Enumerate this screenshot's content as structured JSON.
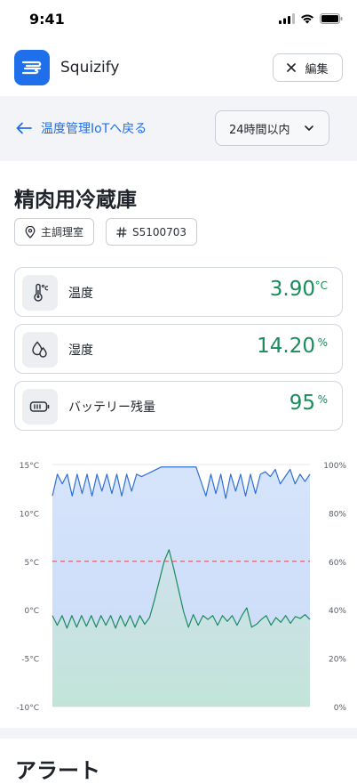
{
  "status": {
    "time": "9:41"
  },
  "app": {
    "name": "Squizify",
    "edit_label": "編集"
  },
  "nav": {
    "back_label": "温度管理IoTへ戻る",
    "range_label": "24時間以内"
  },
  "device": {
    "name": "精肉用冷蔵庫",
    "location": "主調理室",
    "serial": "S5100703"
  },
  "metrics": [
    {
      "icon": "thermometer-icon",
      "label": "温度",
      "value": "3.90",
      "unit": "°C"
    },
    {
      "icon": "humidity-icon",
      "label": "湿度",
      "value": "14.20",
      "unit": "%"
    },
    {
      "icon": "battery-icon",
      "label": "バッテリー残量",
      "value": "95",
      "unit": "%"
    }
  ],
  "colors": {
    "accent": "#1f6feb",
    "value_green": "#1a8c5c",
    "threshold_red": "#e0454f"
  },
  "chart_data": {
    "type": "area",
    "left_axis": {
      "label": "",
      "unit": "°C",
      "ticks": [
        "15°C",
        "10°C",
        "5°C",
        "0°C",
        "-5°C",
        "-10°C"
      ],
      "range": [
        -10,
        15
      ]
    },
    "right_axis": {
      "label": "",
      "unit": "%",
      "ticks": [
        "100%",
        "80%",
        "60%",
        "40%",
        "20%",
        "0%"
      ],
      "range": [
        0,
        100
      ]
    },
    "threshold": 5,
    "series": [
      {
        "axis": "right",
        "color": "#2f6fd6",
        "values": [
          87,
          96,
          92,
          96,
          87,
          96,
          88,
          96,
          87,
          96,
          89,
          96,
          88,
          96,
          87,
          96,
          89,
          96,
          95,
          96,
          97,
          98,
          99,
          99,
          99,
          99,
          99,
          99,
          99,
          99,
          93,
          87,
          96,
          88,
          96,
          86,
          96,
          89,
          96,
          87,
          96,
          88,
          96,
          97,
          95,
          98,
          92,
          95,
          98,
          92,
          96,
          93,
          96
        ]
      },
      {
        "axis": "left",
        "color": "#1a8c5c",
        "values": [
          -0.6,
          -1.6,
          -0.6,
          -1.9,
          -0.6,
          -1.8,
          -0.6,
          -1.7,
          -0.6,
          -1.8,
          -0.6,
          -1.6,
          -0.6,
          -1.9,
          -0.6,
          -1.7,
          -0.6,
          -1.8,
          -0.6,
          -1.5,
          -0.8,
          1.0,
          3.0,
          5.0,
          6.2,
          4.2,
          2.0,
          -0.2,
          -1.8,
          -0.5,
          -1.6,
          -0.6,
          -1.0,
          -0.6,
          -1.6,
          -0.6,
          -1.2,
          -0.6,
          -1.6,
          -0.6,
          0.2,
          -1.8,
          -1.5,
          -1.0,
          -0.6,
          -1.6,
          -0.8,
          -1.3,
          -0.6,
          -1.4,
          -0.7,
          -0.9,
          -0.5,
          -1.0
        ]
      }
    ]
  },
  "alerts": {
    "title": "アラート"
  }
}
